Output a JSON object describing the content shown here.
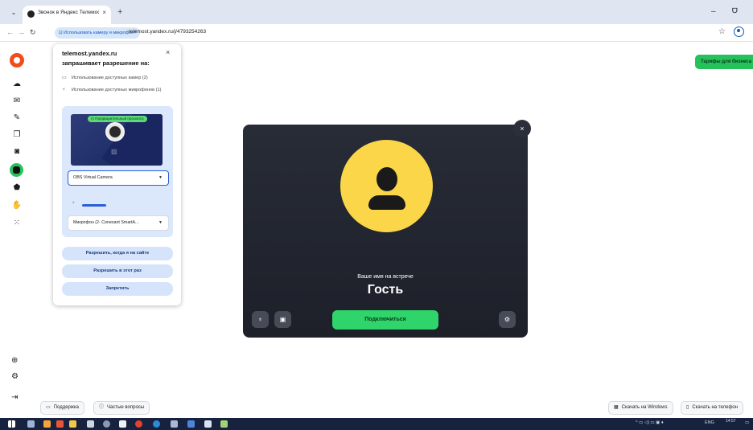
{
  "browser": {
    "tab_title": "Звонок в Яндекс Телемосте",
    "tab_close": "×",
    "new_tab": "+",
    "win_minimize": "–",
    "win_maximize": "ᗜ",
    "address": {
      "permission_chip": "Использовать камеру и микрофон?",
      "url": "telemost.yandex.ru/j/4793254263"
    }
  },
  "permission_popup": {
    "site": "telemost.yandex.ru",
    "subtitle": "запрашивает разрешение на:",
    "close": "×",
    "camera_permission": "Использование доступных камер (2)",
    "mic_permission": "Использование доступных микрофонов (1)",
    "preview_badge": "Предварительный просмотр",
    "camera_select": "OBS Virtual Camera",
    "mic_select": "Микрофон (2- Conexant SmartA...",
    "mic_level_percent": 30,
    "buttons": {
      "allow_on_site": "Разрешить, когда я на сайте",
      "allow_once": "Разрешить в этот раз",
      "deny": "Запретить"
    }
  },
  "business_button": "Тарифы для бизнеса",
  "meeting": {
    "name_caption": "Ваше имя на встрече",
    "name_value": "Гость",
    "join_button": "Подключиться",
    "close": "×"
  },
  "bottom": {
    "support": "Поддержка",
    "faq": "Частые вопросы",
    "download_windows": "Скачать на Windows",
    "download_phone": "Скачать на телефон"
  },
  "taskbar": {
    "language": "ENG",
    "time": "14:57"
  },
  "icons": {
    "sidebar": [
      "yandex-logo-icon",
      "cloud-icon",
      "mail-icon",
      "pen-icon",
      "copy-icon",
      "disk-icon",
      "telemost-icon",
      "tag-icon",
      "hand-icon",
      "apps-grid-icon"
    ],
    "accent": "#27c15c",
    "card_bg": "#282c37",
    "avatar_yellow": "#fad648"
  }
}
